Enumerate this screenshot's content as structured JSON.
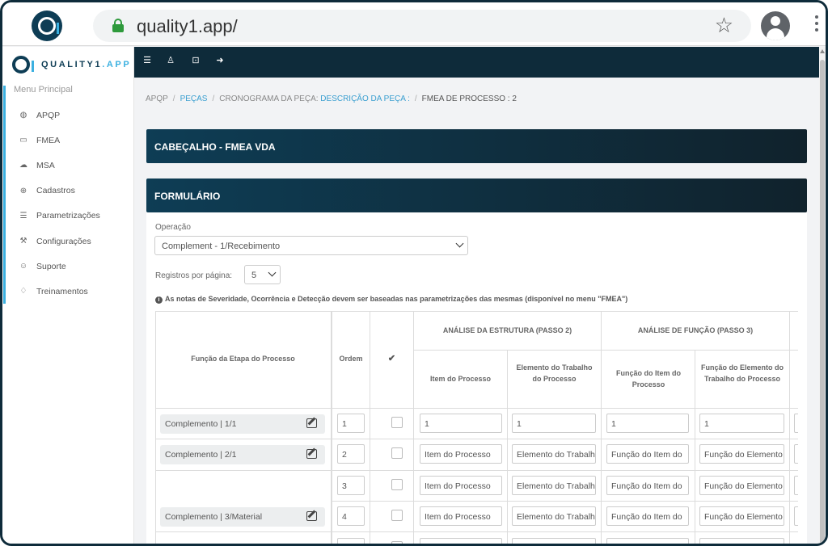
{
  "browser": {
    "url": "quality1.app/"
  },
  "brand": {
    "name_main": "QUALITY1",
    "name_accent": ".APP"
  },
  "sidebar": {
    "menu_title": "Menu Principal",
    "items": [
      {
        "label": "APQP",
        "icon": "globe-icon"
      },
      {
        "label": "FMEA",
        "icon": "folder-icon"
      },
      {
        "label": "MSA",
        "icon": "cloud-icon"
      },
      {
        "label": "Cadastros",
        "icon": "plus-circle-icon"
      },
      {
        "label": "Parametrizações",
        "icon": "list-icon"
      },
      {
        "label": "Configurações",
        "icon": "wrench-icon"
      },
      {
        "label": "Suporte",
        "icon": "support-icon"
      },
      {
        "label": "Treinamentos",
        "icon": "graduation-cap-icon"
      }
    ]
  },
  "breadcrumb": {
    "apqp": "APQP",
    "pecas": "PEÇAS",
    "cronograma": "CRONOGRAMA DA PEÇA:",
    "descricao": "DESCRIÇÃO DA PEÇA :",
    "current": "FMEA DE PROCESSO : 2"
  },
  "panels": {
    "header_title": "CABEÇALHO - FMEA VDA",
    "form_title": "FORMULÁRIO"
  },
  "form": {
    "operacao_label": "Operação",
    "operacao_value": "Complement - 1/Recebimento",
    "registros_label": "Registros por página:",
    "registros_value": "5",
    "note": "As notas de Severidade, Ocorrência e Detecção devem ser baseadas nas parametrizações das mesmas (disponível no menu \"FMEA\")"
  },
  "table": {
    "col_funcao_etapa": "Função da Etapa do Processo",
    "col_ordem": "Ordem",
    "col_check": "✔",
    "group_estrutura": "ANÁLISE DA ESTRUTURA (PASSO 2)",
    "group_funcao": "ANÁLISE DE FUNÇÃO (PASSO 3)",
    "col_item_processo": "Item do Processo",
    "col_elemento_trabalho": "Elemento do Trabalho do Processo",
    "col_funcao_item": "Função do Item do Processo",
    "col_funcao_elemento": "Função do Elemento do Trabalho do Processo",
    "rows": [
      {
        "funcao": "Complemento | 1/1",
        "ordem": "1",
        "item": "1",
        "elemento": "1",
        "funcao_item": "1",
        "funcao_elemento": "1"
      },
      {
        "funcao": "Complemento | 2/1",
        "ordem": "2",
        "item": "Item do Processo",
        "elemento": "Elemento do Trabalho",
        "funcao_item": "Função do Item do",
        "funcao_elemento": "Função do Elemento"
      },
      {
        "funcao": "",
        "ordem": "3",
        "item": "Item do Processo",
        "elemento": "Elemento do Trabalho",
        "funcao_item": "Função do Item do",
        "funcao_elemento": "Função do Elemento"
      },
      {
        "funcao": "Complemento | 3/Material",
        "ordem": "4",
        "item": "Item do Processo",
        "elemento": "Elemento do Trabalho",
        "funcao_item": "Função do Item do",
        "funcao_elemento": "Função do Elemento"
      }
    ]
  }
}
